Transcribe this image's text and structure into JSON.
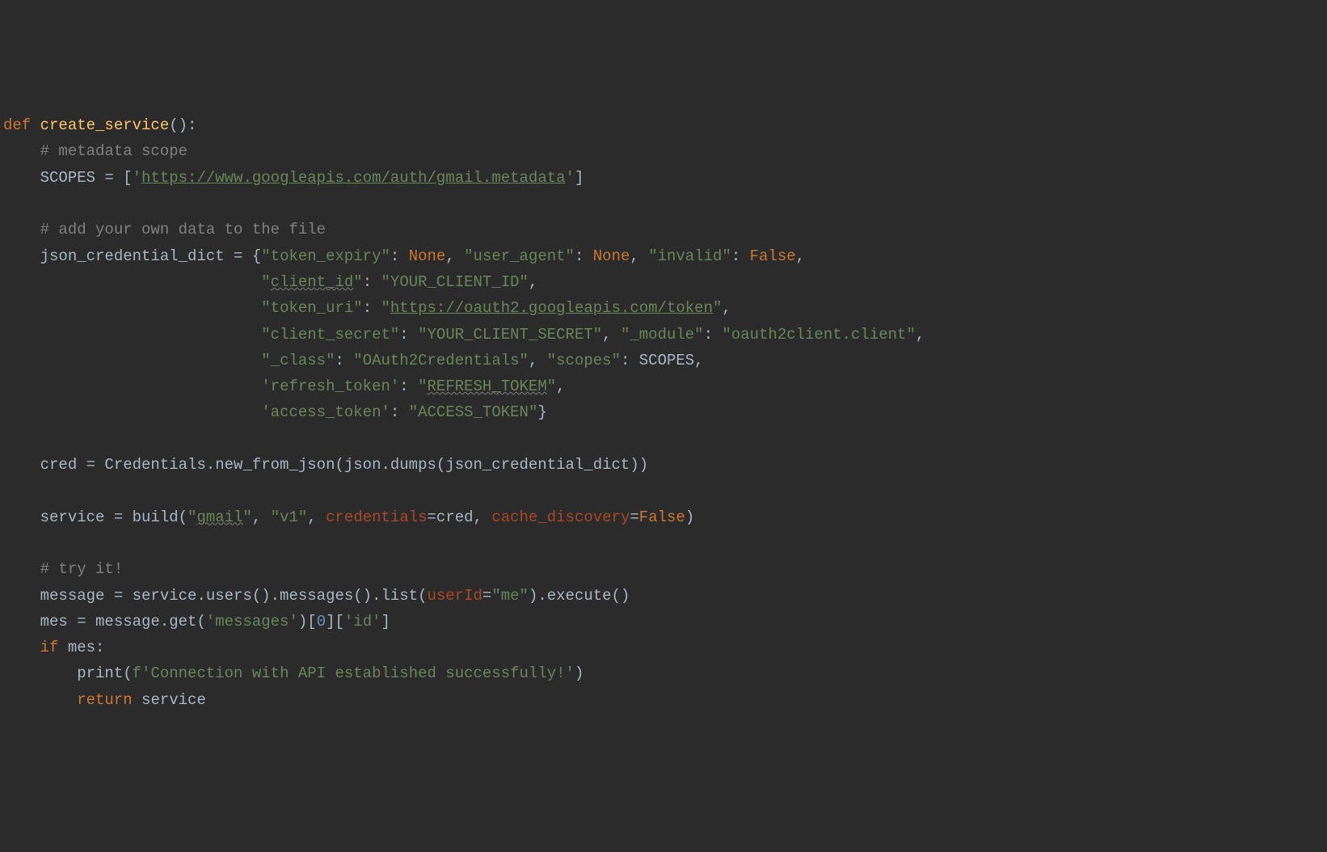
{
  "code": {
    "l1": {
      "def": "def ",
      "fname": "create_service",
      "rest": "():"
    },
    "l2": {
      "cm": "    # metadata scope"
    },
    "l3": {
      "a": "    SCOPES = [",
      "q1": "'",
      "url": "https://www.googleapis.com/auth/gmail.metadata",
      "q2": "'",
      "b": "]"
    },
    "l4": "",
    "l5": {
      "cm": "    # add your own data to the file"
    },
    "l6": {
      "a": "    json_credential_dict = {",
      "k1": "\"token_expiry\"",
      "c1": ": ",
      "v1": "None",
      "c2": ", ",
      "k2": "\"user_agent\"",
      "c3": ": ",
      "v2": "None",
      "c4": ", ",
      "k3": "\"invalid\"",
      "c5": ": ",
      "v3": "False",
      "c6": ","
    },
    "l7": {
      "pre": "                            ",
      "q1": "\"",
      "k": "client_id",
      "q2": "\"",
      "c1": ": ",
      "v": "\"YOUR_CLIENT_ID\"",
      "c2": ","
    },
    "l8": {
      "pre": "                            ",
      "k": "\"token_uri\"",
      "c1": ": ",
      "q1": "\"",
      "url": "https://oauth2.googleapis.com/token",
      "q2": "\"",
      "c2": ","
    },
    "l9": {
      "pre": "                            ",
      "k1": "\"client_secret\"",
      "c1": ": ",
      "v1": "\"YOUR_CLIENT_SECRET\"",
      "c2": ", ",
      "k2": "\"_module\"",
      "c3": ": ",
      "v2": "\"oauth2client.client\"",
      "c4": ","
    },
    "l10": {
      "pre": "                            ",
      "k1": "\"_class\"",
      "c1": ": ",
      "v1": "\"OAuth2Credentials\"",
      "c2": ", ",
      "k2": "\"scopes\"",
      "c3": ": SCOPES,"
    },
    "l11": {
      "pre": "                            ",
      "k": "'refresh_token'",
      "c1": ": ",
      "q1": "\"",
      "v": "REFRESH_TOKEM",
      "q2": "\"",
      "c2": ","
    },
    "l12": {
      "pre": "                            ",
      "k": "'access_token'",
      "c1": ": ",
      "v": "\"ACCESS_TOKEN\"",
      "c2": "}"
    },
    "l13": "",
    "l14": {
      "a": "    cred = Credentials.new_from_json(json.dumps(json_credential_dict))"
    },
    "l15": "",
    "l16": {
      "a": "    service = build(",
      "q1": "\"",
      "s1": "gmail",
      "q2": "\"",
      "c1": ", ",
      "s2": "\"v1\"",
      "c2": ", ",
      "p1": "credentials",
      "e1": "=cred, ",
      "p2": "cache_discovery",
      "e2": "=",
      "v": "False",
      "c3": ")"
    },
    "l17": "",
    "l18": {
      "cm": "    # try it!"
    },
    "l19": {
      "a": "    message = service.users().messages().list(",
      "p": "userId",
      "e": "=",
      "v": "\"me\"",
      "b": ").execute()"
    },
    "l20": {
      "a": "    mes = message.get(",
      "s": "'messages'",
      "b": ")[",
      "n": "0",
      "c": "][",
      "s2": "'id'",
      "d": "]"
    },
    "l21": {
      "a": "    ",
      "kw": "if ",
      "b": "mes:"
    },
    "l22": {
      "a": "        print(",
      "f": "f'Connection with API established successfully!'",
      "b": ")"
    },
    "l23": {
      "a": "        ",
      "kw": "return ",
      "b": "service"
    }
  }
}
